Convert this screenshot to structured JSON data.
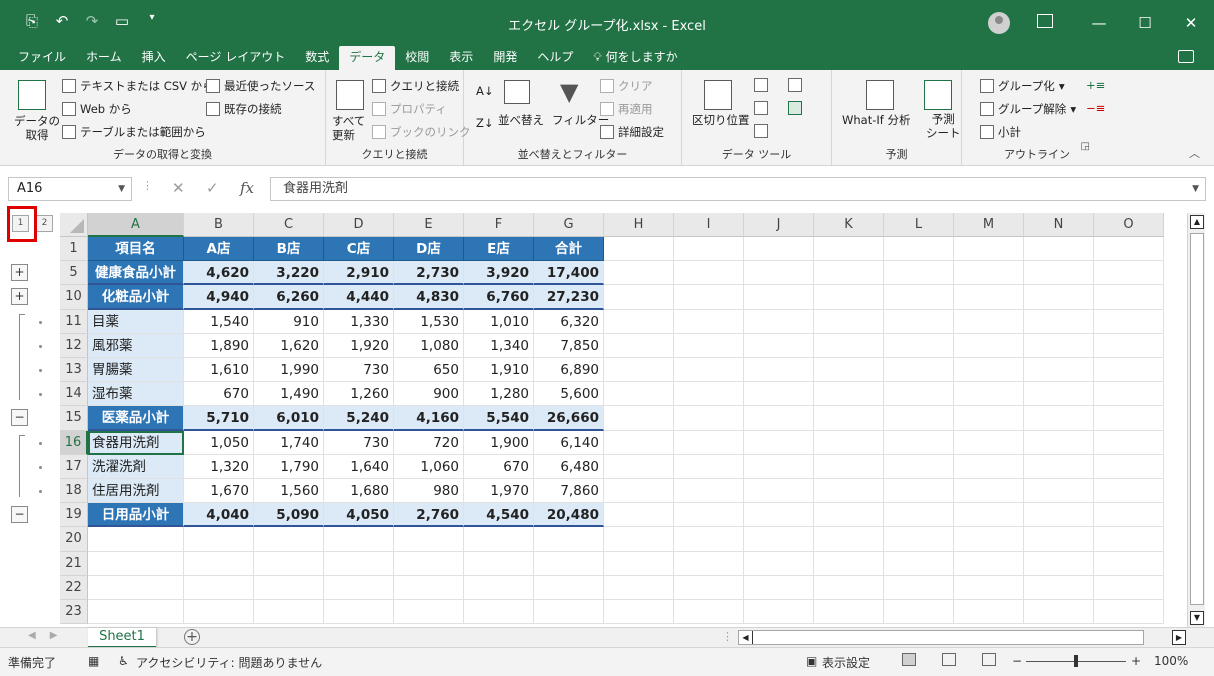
{
  "window": {
    "title": "エクセル グループ化.xlsx  -  Excel",
    "qat_icons": [
      "autosave-icon",
      "undo-icon",
      "redo-icon",
      "print-preview-icon",
      "customize-qat-icon"
    ],
    "controls": [
      "minimize-icon",
      "restore-icon",
      "close-icon"
    ]
  },
  "tabs": [
    {
      "label": "ファイル"
    },
    {
      "label": "ホーム"
    },
    {
      "label": "挿入"
    },
    {
      "label": "ページ レイアウト"
    },
    {
      "label": "数式"
    },
    {
      "label": "データ",
      "active": true
    },
    {
      "label": "校閲"
    },
    {
      "label": "表示"
    },
    {
      "label": "開発"
    },
    {
      "label": "ヘルプ"
    },
    {
      "label": "何をしますか"
    }
  ],
  "ribbon": {
    "get_data": {
      "big_label": "データの\n取得",
      "items": [
        "テキストまたは CSV から",
        "Web から",
        "テーブルまたは範囲から",
        "最近使ったソース",
        "既存の接続"
      ],
      "group_label": "データの取得と変換"
    },
    "queries": {
      "big_label": "すべて\n更新",
      "items": [
        "クエリと接続",
        "プロパティ",
        "ブックのリンク"
      ],
      "group_label": "クエリと接続"
    },
    "sort_filter": {
      "items": [
        "並べ替え",
        "フィルター",
        "クリア",
        "再適用",
        "詳細設定"
      ],
      "group_label": "並べ替えとフィルター"
    },
    "data_tools": {
      "items": [
        "区切り位置"
      ],
      "group_label": "データ ツール"
    },
    "forecast": {
      "items": [
        "What-If 分析",
        "予測\nシート"
      ],
      "group_label": "予測"
    },
    "outline": {
      "items": [
        "グループ化",
        "グループ解除",
        "小計"
      ],
      "group_label": "アウトライン"
    }
  },
  "formula_bar": {
    "name_box": "A16",
    "cancel": "✕",
    "enter": "✓",
    "fx": "fx",
    "content": "食器用洗剤"
  },
  "outline_levels": [
    "1",
    "2"
  ],
  "columns": [
    "A",
    "B",
    "C",
    "D",
    "E",
    "F",
    "G",
    "H",
    "I",
    "J",
    "K",
    "L",
    "M",
    "N",
    "O"
  ],
  "rows": [
    {
      "num": "1",
      "type": "header",
      "cells": [
        "項目名",
        "A店",
        "B店",
        "C店",
        "D店",
        "E店",
        "合計"
      ]
    },
    {
      "num": "5",
      "type": "subtotal",
      "outline": "+",
      "cells": [
        "健康食品小計",
        "4,620",
        "3,220",
        "2,910",
        "2,730",
        "3,920",
        "17,400"
      ]
    },
    {
      "num": "10",
      "type": "subtotal",
      "outline": "+",
      "cells": [
        "化粧品小計",
        "4,940",
        "6,260",
        "4,440",
        "4,830",
        "6,760",
        "27,230"
      ]
    },
    {
      "num": "11",
      "type": "item",
      "outline": "dot",
      "cells": [
        "目薬",
        "1,540",
        "910",
        "1,330",
        "1,530",
        "1,010",
        "6,320"
      ]
    },
    {
      "num": "12",
      "type": "item",
      "outline": "dot",
      "cells": [
        "風邪薬",
        "1,890",
        "1,620",
        "1,920",
        "1,080",
        "1,340",
        "7,850"
      ]
    },
    {
      "num": "13",
      "type": "item",
      "outline": "dot",
      "cells": [
        "胃腸薬",
        "1,610",
        "1,990",
        "730",
        "650",
        "1,910",
        "6,890"
      ]
    },
    {
      "num": "14",
      "type": "item",
      "outline": "dot",
      "cells": [
        "湿布薬",
        "670",
        "1,490",
        "1,260",
        "900",
        "1,280",
        "5,600"
      ]
    },
    {
      "num": "15",
      "type": "subtotal",
      "outline": "−",
      "cells": [
        "医薬品小計",
        "5,710",
        "6,010",
        "5,240",
        "4,160",
        "5,540",
        "26,660"
      ]
    },
    {
      "num": "16",
      "type": "item",
      "outline": "dot",
      "active": true,
      "cells": [
        "食器用洗剤",
        "1,050",
        "1,740",
        "730",
        "720",
        "1,900",
        "6,140"
      ]
    },
    {
      "num": "17",
      "type": "item",
      "outline": "dot",
      "cells": [
        "洗濯洗剤",
        "1,320",
        "1,790",
        "1,640",
        "1,060",
        "670",
        "6,480"
      ]
    },
    {
      "num": "18",
      "type": "item",
      "outline": "dot",
      "cells": [
        "住居用洗剤",
        "1,670",
        "1,560",
        "1,680",
        "980",
        "1,970",
        "7,860"
      ]
    },
    {
      "num": "19",
      "type": "subtotal",
      "outline": "−",
      "cells": [
        "日用品小計",
        "4,040",
        "5,090",
        "4,050",
        "2,760",
        "4,540",
        "20,480"
      ]
    },
    {
      "num": "20",
      "type": "empty",
      "cells": []
    },
    {
      "num": "21",
      "type": "empty",
      "cells": []
    },
    {
      "num": "22",
      "type": "empty",
      "cells": []
    },
    {
      "num": "23",
      "type": "empty",
      "cells": []
    }
  ],
  "sheet": {
    "tab": "Sheet1",
    "add": "+"
  },
  "status": {
    "ready": "準備完了",
    "accessibility": "アクセシビリティ: 問題ありません",
    "display_settings": "表示設定",
    "zoom": "100%",
    "zoom_minus": "−",
    "zoom_plus": "+"
  },
  "colors": {
    "accent": "#217346",
    "header_fill": "#2e75b6",
    "subtotal_fill": "#dce9f6",
    "highlight": "#e00000"
  }
}
